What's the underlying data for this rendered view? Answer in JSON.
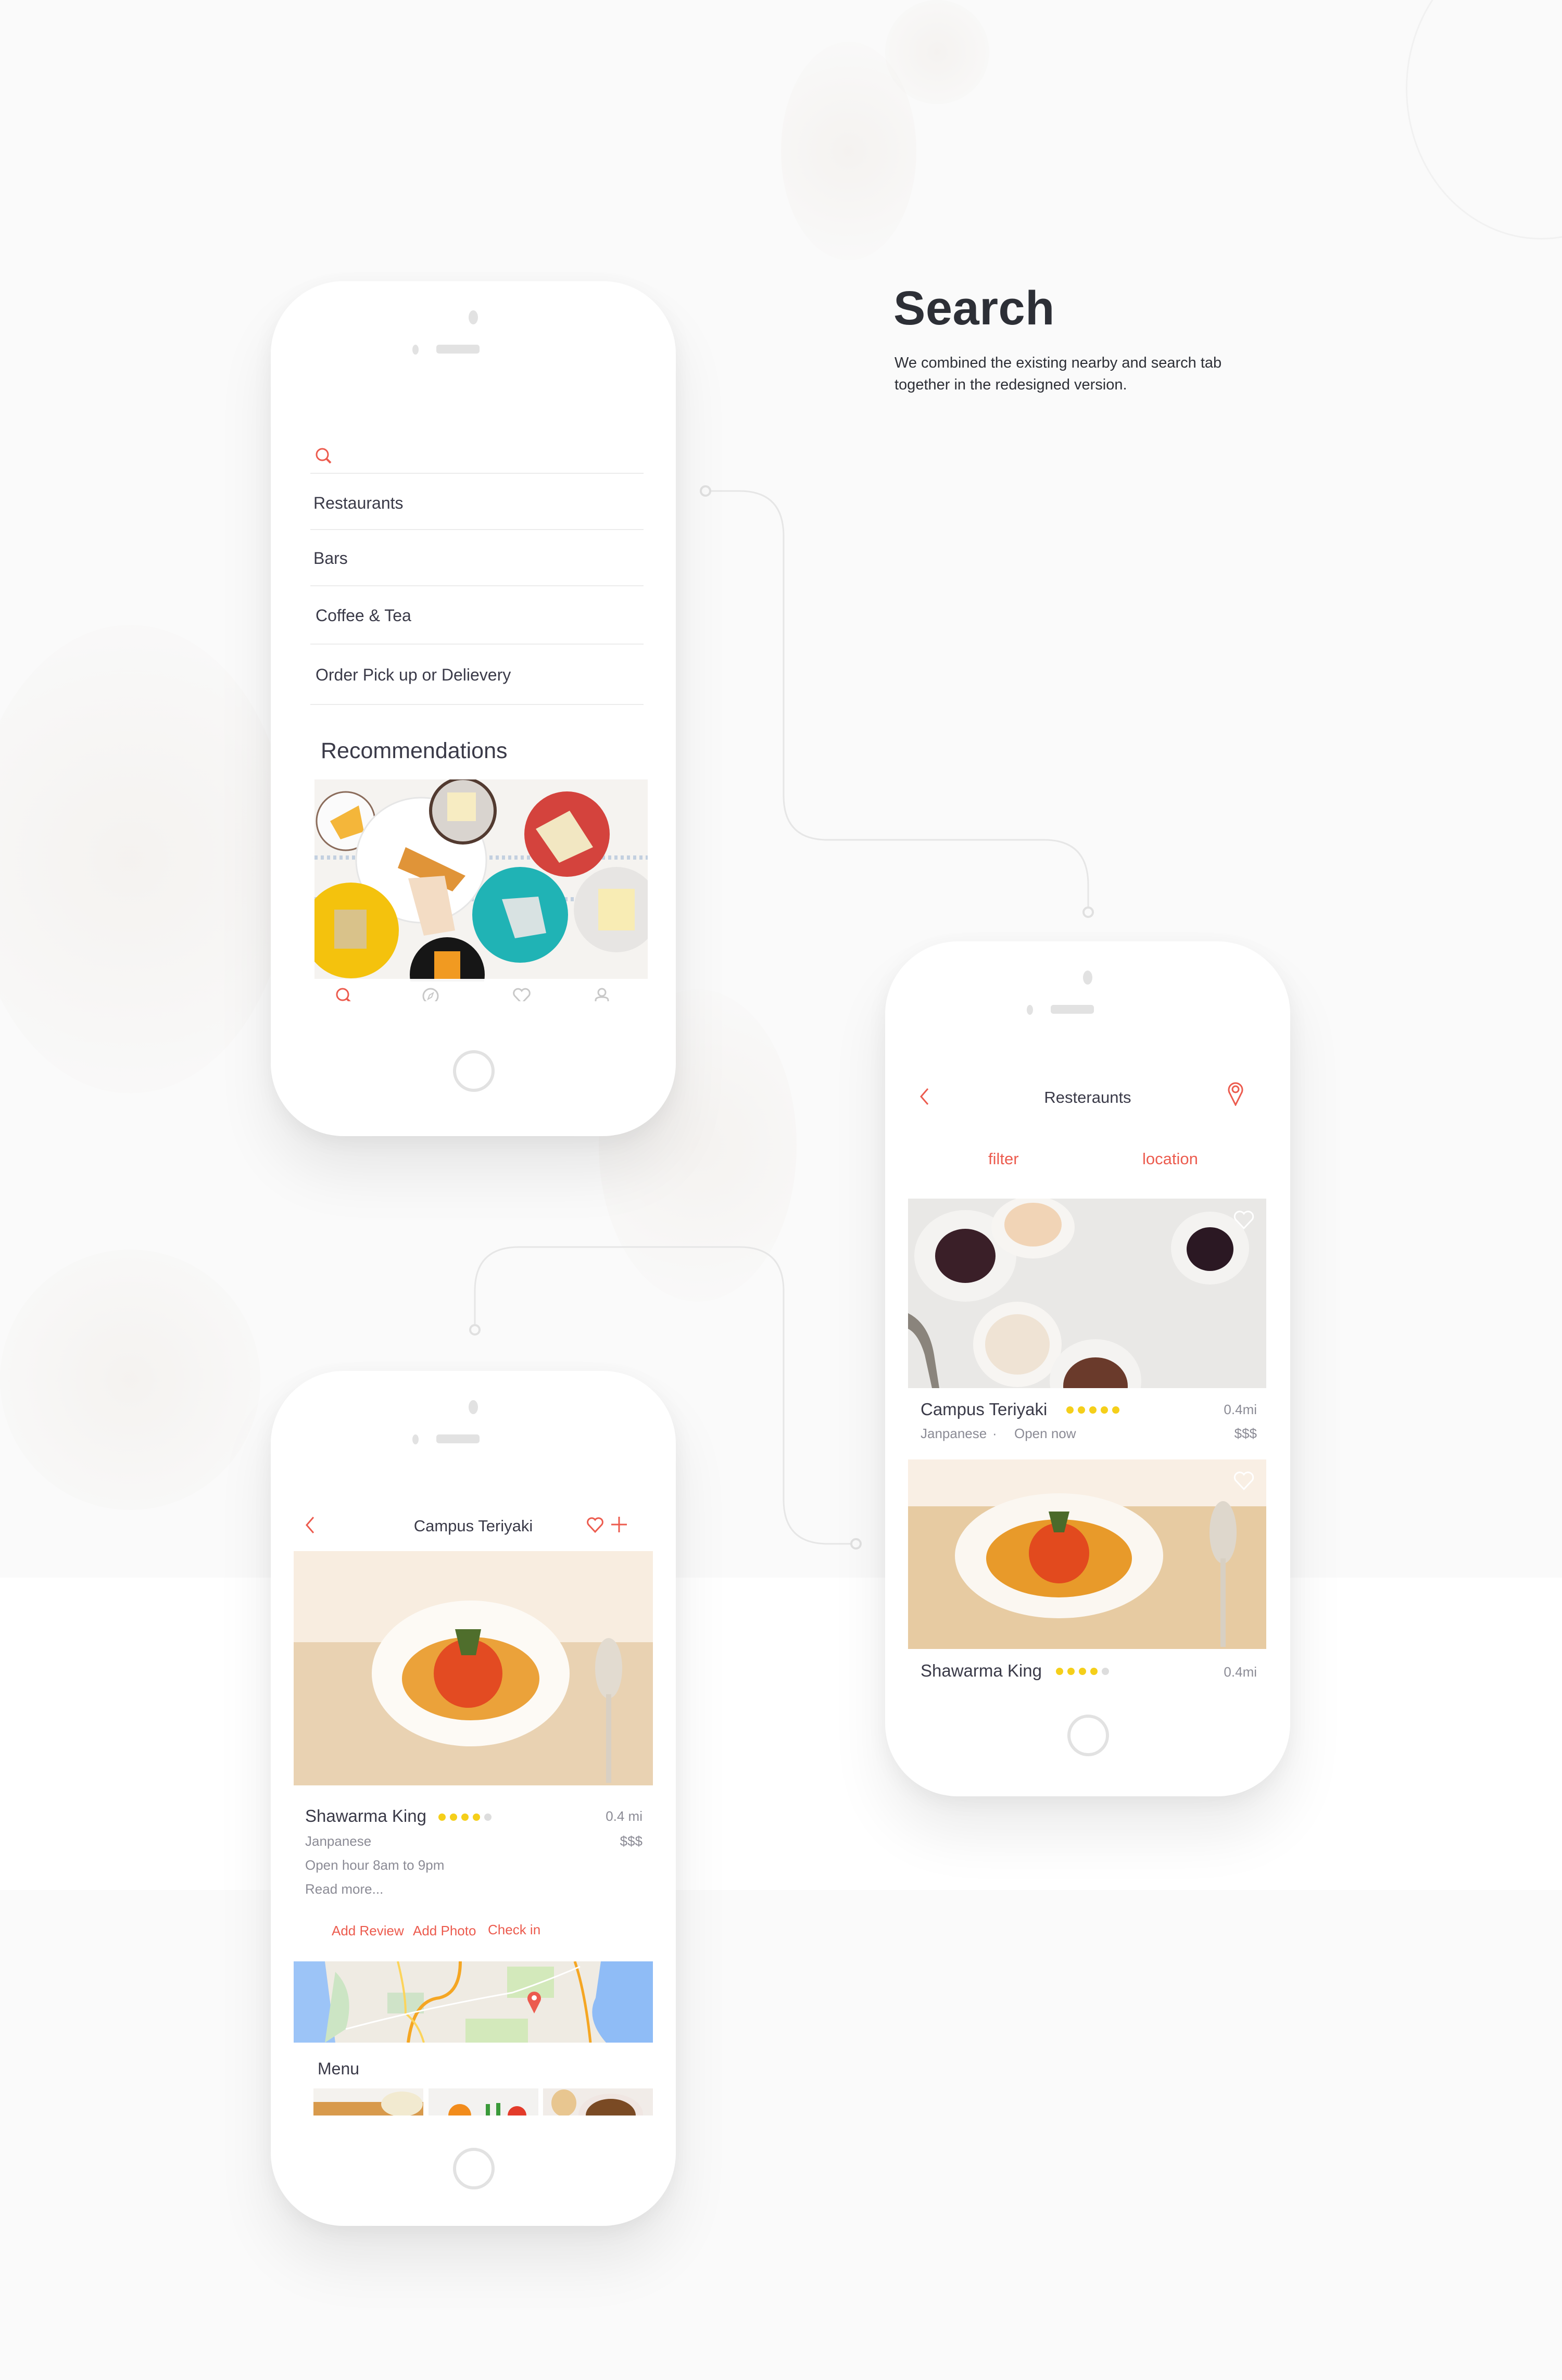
{
  "section": {
    "title": "Search",
    "description": "We combined the existing nearby and search tab together in the redesigned version."
  },
  "colors": {
    "accent": "#ec5b4e",
    "rating_on": "#f5cf1a",
    "rating_off": "#dddddd",
    "text_primary": "#3a3a48",
    "text_secondary": "#8b8b95",
    "background": "#fafafa"
  },
  "phone_search": {
    "search_icon": "search-icon",
    "search_placeholder": "",
    "categories": [
      {
        "label": "Restaurants"
      },
      {
        "label": "Bars"
      },
      {
        "label": "Coffee & Tea"
      },
      {
        "label": "Order Pick up or Delievery"
      }
    ],
    "recommendations_title": "Recommendations",
    "recommendation_image": "cheese-platter-photo",
    "tabbar": [
      {
        "name": "search",
        "icon": "search-icon",
        "active": true
      },
      {
        "name": "explore",
        "icon": "compass-icon",
        "active": false
      },
      {
        "name": "favorites",
        "icon": "heart-icon",
        "active": false
      },
      {
        "name": "profile",
        "icon": "user-icon",
        "active": false
      }
    ]
  },
  "phone_list": {
    "title": "Resteraunts",
    "back_icon": "chevron-left-icon",
    "location_icon": "map-pin-icon",
    "filter_label": "filter",
    "location_label": "location",
    "results": [
      {
        "name": "Campus Teriyaki",
        "rating": 5,
        "rating_max": 5,
        "distance": "0.4mi",
        "cuisine": "Janpanese",
        "separator": "·",
        "status": "Open now",
        "price": "$$$",
        "image": "sauces-photo"
      },
      {
        "name": "Shawarma King",
        "rating": 4,
        "rating_max": 5,
        "distance": "0.4mi",
        "image": "tomato-soup-photo"
      }
    ]
  },
  "phone_detail": {
    "title": "Campus Teriyaki",
    "back_icon": "chevron-left-icon",
    "heart_icon": "heart-icon",
    "add_icon": "plus-icon",
    "name": "Shawarma King",
    "rating": 4,
    "rating_max": 5,
    "distance": "0.4 mi",
    "cuisine": "Janpanese",
    "price": "$$$",
    "hours": "Open hour 8am to 9pm",
    "read_more": "Read more...",
    "actions": [
      {
        "label": "Add Review"
      },
      {
        "label": "Add Photo"
      },
      {
        "label": "Check in"
      }
    ],
    "menu_title": "Menu",
    "menu_items": [
      "pancake-photo",
      "salad-photo",
      "broth-photo"
    ]
  }
}
